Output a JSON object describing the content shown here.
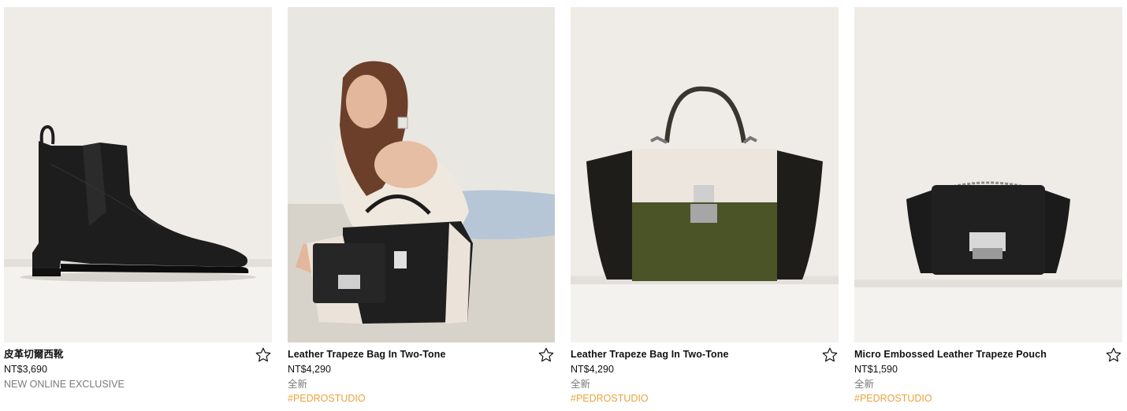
{
  "products": [
    {
      "name": "皮革切爾西靴",
      "price": "NT$3,690",
      "tag": "NEW ONLINE EXCLUSIVE",
      "hashtag": "",
      "image": "black-chelsea-boot",
      "wishlist_icon": "star-outline-icon"
    },
    {
      "name": "Leather Trapeze Bag In Two-Tone",
      "price": "NT$4,290",
      "tag": "全新",
      "hashtag": "#PEDROSTUDIO",
      "image": "model-with-black-trapeze-bag",
      "wishlist_icon": "star-outline-icon"
    },
    {
      "name": "Leather Trapeze Bag In Two-Tone",
      "price": "NT$4,290",
      "tag": "全新",
      "hashtag": "#PEDROSTUDIO",
      "image": "two-tone-green-trapeze-bag",
      "wishlist_icon": "star-outline-icon"
    },
    {
      "name": "Micro Embossed Leather Trapeze Pouch",
      "price": "NT$1,590",
      "tag": "全新",
      "hashtag": "#PEDROSTUDIO",
      "image": "black-trapeze-pouch",
      "wishlist_icon": "star-outline-icon"
    }
  ],
  "colors": {
    "hashtag": "#e8a33c",
    "tag_gray": "#7a7a7a",
    "image_bg": "#eceae6"
  }
}
